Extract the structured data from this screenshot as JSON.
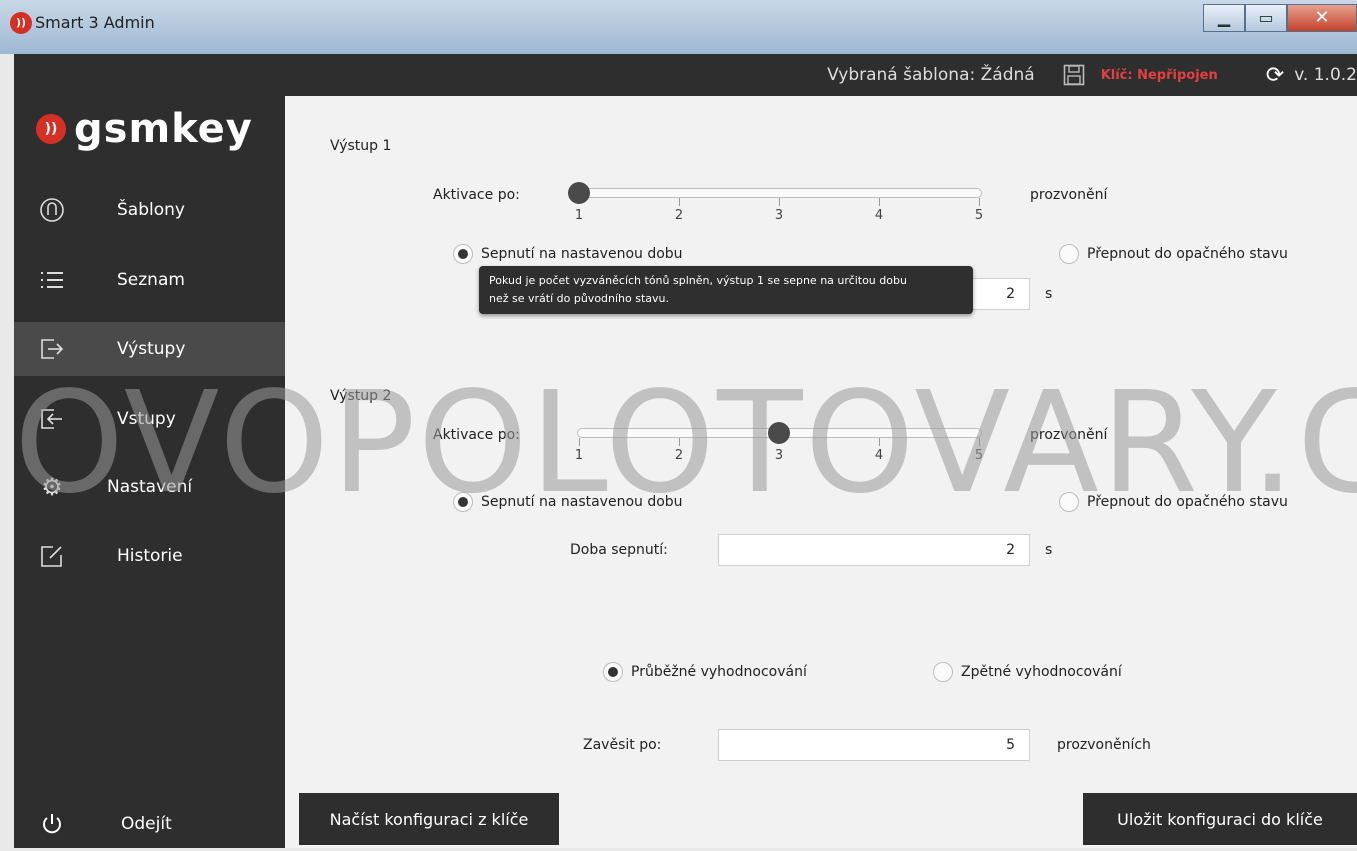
{
  "window": {
    "title": "Smart 3 Admin",
    "app_icon": "gsmkey-app-icon"
  },
  "topbar": {
    "template_label": "Vybraná šablona: Žádná",
    "key_status": "Klíč: Nepřipojen",
    "key_status_color": "#e04040",
    "version": "v. 1.0.2"
  },
  "sidebar": {
    "logo_text": "gsmkey",
    "items": [
      {
        "label": "Šablony",
        "icon": "templates-icon"
      },
      {
        "label": "Seznam",
        "icon": "list-icon"
      },
      {
        "label": "Výstupy",
        "icon": "output-icon",
        "active": true
      },
      {
        "label": "Vstupy",
        "icon": "input-icon"
      },
      {
        "label": "Nastavení",
        "icon": "gear-icon"
      },
      {
        "label": "Historie",
        "icon": "edit-icon"
      }
    ],
    "exit_label": "Odejít"
  },
  "output1": {
    "title": "Výstup 1",
    "activation_label": "Aktivace po:",
    "activation_value": 1,
    "tick_labels": [
      "1",
      "2",
      "3",
      "4",
      "5"
    ],
    "unit_label": "prozvonění",
    "radio_timed": "Sepnutí na nastavenou dobu",
    "radio_toggle": "Přepnout do opačného stavu",
    "duration_value": "2",
    "duration_unit": "s",
    "tooltip_line1": "Pokud je počet vyzváněcích tónů splněn, výstup 1 se sepne na určitou dobu",
    "tooltip_line2": "než se vrátí do původního stavu."
  },
  "output2": {
    "title": "Výstup 2",
    "activation_label": "Aktivace po:",
    "activation_value": 3,
    "tick_labels": [
      "1",
      "2",
      "3",
      "4",
      "5"
    ],
    "unit_label": "prozvonění",
    "radio_timed": "Sepnutí na nastavenou dobu",
    "radio_toggle": "Přepnout do opačného stavu",
    "duration_label": "Doba sepnutí:",
    "duration_value": "2",
    "duration_unit": "s"
  },
  "evaluation": {
    "radio_continuous": "Průběžné vyhodnocování",
    "radio_backward": "Zpětné vyhodnocování",
    "hangup_label": "Zavěsit po:",
    "hangup_value": "5",
    "hangup_unit": "prozvoněních"
  },
  "buttons": {
    "load": "Načíst konfiguraci z klíče",
    "save": "Uložit konfiguraci do klíče"
  },
  "watermark": "OVOPOLOTOVARY.C"
}
